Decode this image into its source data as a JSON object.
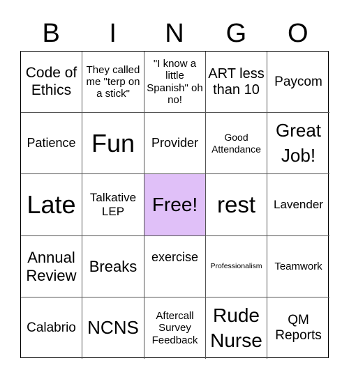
{
  "header": {
    "letters": [
      "B",
      "I",
      "N",
      "G",
      "O"
    ]
  },
  "free_cell_color": "#e0c0f8",
  "board": {
    "rows": [
      [
        "Code of Ethics",
        "They called me \"terp on a stick\"",
        "\"I know a little Spanish\" oh no!",
        "ART less than 10",
        "Paycom"
      ],
      [
        "Patience",
        "Fun",
        "Provider",
        "Good Attendance",
        "Great Job!"
      ],
      [
        "Late",
        "Talkative LEP",
        "Free!",
        "rest",
        "Lavender"
      ],
      [
        "Annual Review",
        "Breaks",
        "exercise",
        "Professionalism",
        "Teamwork"
      ],
      [
        "Calabrio",
        "NCNS",
        "Aftercall Survey Feedback",
        "Rude Nurse",
        "QM Reports"
      ]
    ]
  }
}
